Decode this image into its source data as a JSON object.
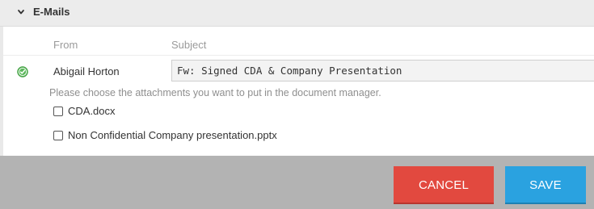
{
  "section": {
    "title": "E-Mails",
    "expanded": true,
    "icon": "chevron-down-icon"
  },
  "columns": {
    "from": "From",
    "subject": "Subject"
  },
  "email": {
    "status_icon": "check-circle-icon",
    "status_color": "#4caf50",
    "from": "Abigail Horton",
    "subject": "Fw: Signed CDA & Company Presentation"
  },
  "attachments": {
    "hint": "Please choose the attachments you want to put in the document manager.",
    "items": [
      {
        "name": "CDA.docx",
        "checked": false
      },
      {
        "name": "Non Confidential Company presentation.pptx",
        "checked": false
      }
    ]
  },
  "footer": {
    "cancel_label": "CANCEL",
    "save_label": "SAVE",
    "cancel_color": "#e2493f",
    "save_color": "#2aa2e0"
  }
}
